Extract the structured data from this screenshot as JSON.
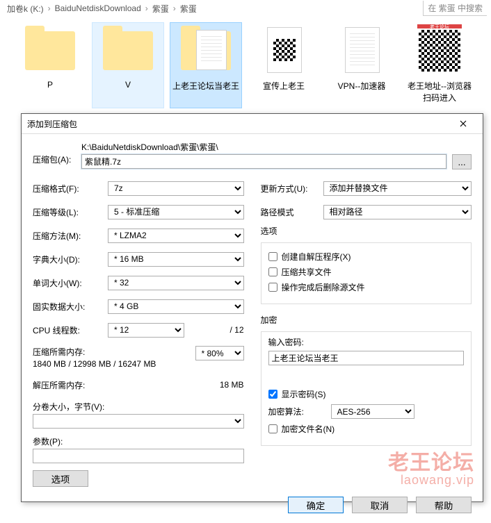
{
  "breadcrumb": {
    "items": [
      "加卷k (K:)",
      "BaiduNetdiskDownload",
      "紫蛋",
      "紫蛋"
    ],
    "search_hint": "在 紫蛋 中搜索"
  },
  "files": [
    {
      "name": "P",
      "kind": "folder-thumb"
    },
    {
      "name": "V",
      "kind": "folder",
      "state": "hover"
    },
    {
      "name": "上老王论坛当老王",
      "kind": "folder-doc",
      "state": "selected"
    },
    {
      "name": "宣传上老王",
      "kind": "doc-qr"
    },
    {
      "name": "VPN--加速器",
      "kind": "doc"
    },
    {
      "name": "老王地址--浏览器扫码进入",
      "kind": "qr",
      "qr_header": "老王论坛"
    }
  ],
  "dialog": {
    "title": "添加到压缩包",
    "archive_label": "压缩包(A):",
    "archive_path_prefix": "K:\\BaiduNetdiskDownload\\紫蛋\\紫蛋\\",
    "archive_value": "紫鼠精.7z",
    "browse_label": "...",
    "left": {
      "format": {
        "label": "压缩格式(F):",
        "value": "7z"
      },
      "level": {
        "label": "压缩等级(L):",
        "value": "5 - 标准压缩"
      },
      "method": {
        "label": "压缩方法(M):",
        "value": "* LZMA2"
      },
      "dict": {
        "label": "字典大小(D):",
        "value": "* 16 MB"
      },
      "word": {
        "label": "单词大小(W):",
        "value": "* 32"
      },
      "solid": {
        "label": "固实数据大小:",
        "value": "* 4 GB"
      },
      "cpu": {
        "label": "CPU 线程数:",
        "value": "* 12",
        "suffix": "/ 12"
      },
      "mem_compress_label": "压缩所需内存:",
      "mem_compress_value": "1840 MB / 12998 MB / 16247 MB",
      "mem_compress_pct": "* 80%",
      "mem_decompress_label": "解压所需内存:",
      "mem_decompress_value": "18 MB",
      "split_label": "分卷大小，字节(V):",
      "split_value": "",
      "params_label": "参数(P):",
      "params_value": "",
      "options_btn": "选项"
    },
    "right": {
      "update": {
        "label": "更新方式(U):",
        "value": "添加并替换文件"
      },
      "pathmode": {
        "label": "路径模式",
        "value": "相对路径"
      },
      "options_title": "选项",
      "sfx_label": "创建自解压程序(X)",
      "shared_label": "压缩共享文件",
      "delete_label": "操作完成后删除源文件",
      "encrypt_title": "加密",
      "pwd_label": "输入密码:",
      "pwd_value": "上老王论坛当老王",
      "show_pwd_label": "显示密码(S)",
      "show_pwd_checked": true,
      "enc_method_label": "加密算法:",
      "enc_method_value": "AES-256",
      "enc_names_label": "加密文件名(N)"
    },
    "buttons": {
      "ok": "确定",
      "cancel": "取消",
      "help": "帮助"
    }
  },
  "watermark": {
    "line1": "老王论坛",
    "line2": "laowang.vip"
  }
}
